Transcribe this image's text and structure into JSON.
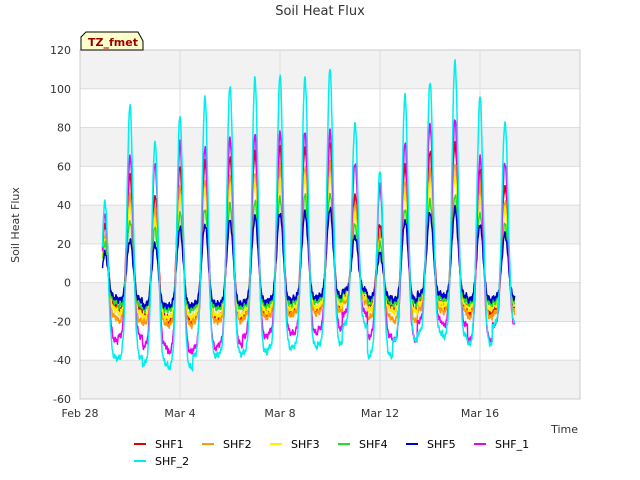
{
  "chart_data": {
    "type": "line",
    "title": "Soil Heat Flux",
    "xlabel": "Time",
    "ylabel": "Soil Heat Flux",
    "badge": "TZ_fmet",
    "x_start": "Feb 28",
    "x_end": "Mar 18",
    "x_range_days": [
      0,
      20
    ],
    "ylim": [
      -60,
      120
    ],
    "y_ticks": [
      -60,
      -40,
      -20,
      0,
      20,
      40,
      60,
      80,
      100,
      120
    ],
    "x_ticks": [
      {
        "label": "Feb 28",
        "day": 0
      },
      {
        "label": "Mar 4",
        "day": 4
      },
      {
        "label": "Mar 8",
        "day": 8
      },
      {
        "label": "Mar 12",
        "day": 12
      },
      {
        "label": "Mar 16",
        "day": 16
      }
    ],
    "grid": true,
    "legend_position": "bottom",
    "days": [
      1,
      2,
      3,
      4,
      5,
      6,
      7,
      8,
      9,
      10,
      11,
      12,
      13,
      14,
      15,
      16,
      17
    ],
    "series": [
      {
        "name": "SHF1",
        "color": "#dd0000",
        "peaks": [
          30,
          55,
          45,
          60,
          62,
          65,
          67,
          70,
          70,
          72,
          45,
          30,
          60,
          68,
          72,
          58,
          50
        ],
        "mins": [
          -12,
          -14,
          -18,
          -20,
          -18,
          -18,
          -16,
          -15,
          -14,
          -13,
          -8,
          -12,
          -14,
          -10,
          -12,
          -16,
          -14
        ]
      },
      {
        "name": "SHF2",
        "color": "#ff9900",
        "peaks": [
          25,
          45,
          38,
          50,
          52,
          55,
          57,
          60,
          60,
          62,
          40,
          25,
          52,
          58,
          62,
          50,
          42
        ],
        "mins": [
          -18,
          -20,
          -21,
          -22,
          -20,
          -20,
          -18,
          -17,
          -16,
          -15,
          -10,
          -18,
          -20,
          -14,
          -15,
          -18,
          -16
        ]
      },
      {
        "name": "SHF3",
        "color": "#ffee00",
        "peaks": [
          22,
          40,
          32,
          45,
          48,
          50,
          52,
          54,
          55,
          56,
          35,
          22,
          46,
          52,
          55,
          45,
          38
        ],
        "mins": [
          -14,
          -16,
          -18,
          -18,
          -17,
          -17,
          -15,
          -14,
          -13,
          -12,
          -8,
          -14,
          -15,
          -11,
          -12,
          -14,
          -12
        ]
      },
      {
        "name": "SHF4",
        "color": "#22dd22",
        "peaks": [
          20,
          32,
          28,
          36,
          38,
          40,
          42,
          44,
          45,
          46,
          30,
          20,
          38,
          42,
          45,
          36,
          30
        ],
        "mins": [
          -10,
          -12,
          -14,
          -14,
          -13,
          -13,
          -12,
          -11,
          -10,
          -9,
          -5,
          -10,
          -11,
          -8,
          -9,
          -11,
          -10
        ]
      },
      {
        "name": "SHF5",
        "color": "#0000cc",
        "peaks": [
          15,
          22,
          20,
          28,
          30,
          32,
          34,
          36,
          36,
          38,
          24,
          15,
          32,
          36,
          38,
          30,
          25
        ],
        "mins": [
          -8,
          -9,
          -12,
          -12,
          -11,
          -11,
          -10,
          -9,
          -8,
          -7,
          -4,
          -8,
          -9,
          -6,
          -7,
          -9,
          -8
        ]
      },
      {
        "name": "SHF_1",
        "color": "#ee00ee",
        "peaks": [
          35,
          65,
          62,
          72,
          70,
          75,
          76,
          78,
          78,
          78,
          62,
          50,
          72,
          82,
          84,
          65,
          62
        ],
        "mins": [
          -30,
          -28,
          -33,
          -36,
          -34,
          -32,
          -28,
          -26,
          -26,
          -24,
          -16,
          -28,
          -30,
          -20,
          -22,
          -30,
          -22
        ]
      },
      {
        "name": "SHF_2",
        "color": "#00eeee",
        "peaks": [
          42,
          91,
          73,
          86,
          95,
          102,
          105,
          107,
          106,
          110,
          82,
          58,
          96,
          104,
          114,
          96,
          83
        ],
        "mins": [
          -39,
          -39,
          -42,
          -44,
          -38,
          -37,
          -36,
          -34,
          -33,
          -32,
          -22,
          -38,
          -30,
          -26,
          -28,
          -32,
          -22
        ]
      }
    ]
  }
}
